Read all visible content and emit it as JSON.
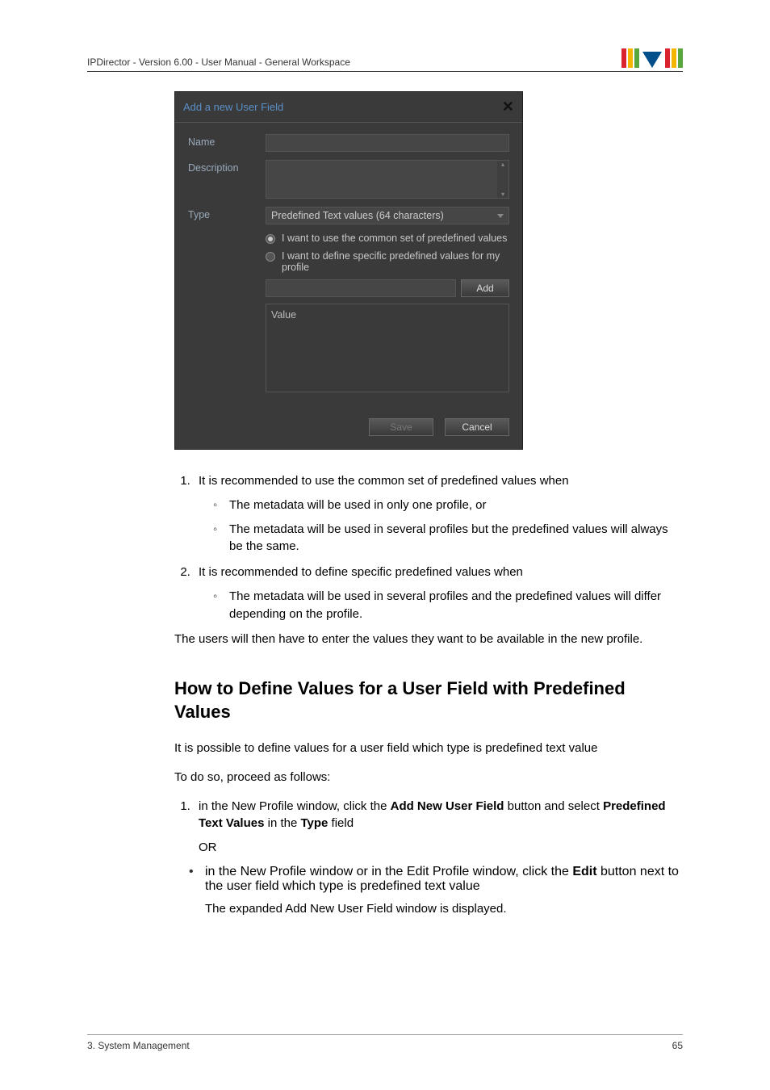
{
  "header": {
    "running_head": "IPDirector - Version 6.00 - User Manual - General Workspace"
  },
  "dialog": {
    "title": "Add a new User Field",
    "close": "✕",
    "labels": {
      "name": "Name",
      "description": "Description",
      "type": "Type"
    },
    "type_value": "Predefined Text values (64 characters)",
    "radio1": "I want to use the common set of predefined values",
    "radio2": "I want to define specific predefined values for my profile",
    "add_label": "Add",
    "value_label": "Value",
    "save_label": "Save",
    "cancel_label": "Cancel"
  },
  "body": {
    "ol1_item1": "It is recommended to use the common set of predefined values when",
    "ol1_item1_sub1": "The metadata will be used in only one profile, or",
    "ol1_item1_sub2": "The metadata will be used in several profiles but the predefined values will always be the same.",
    "ol1_item2": "It is recommended to define specific predefined values when",
    "ol1_item2_sub1": "The metadata will be used in several profiles and the predefined values will differ depending on the profile.",
    "para_after": "The users will then have to enter the values they want to be available in the new profile.",
    "heading2": "How to Define Values for a User Field with Predefined Values",
    "para_intro": "It is possible to define values for a user field which type is predefined text value",
    "para_proceed": "To do so, proceed as follows:",
    "step1_pre": "in the New Profile window, click the ",
    "step1_bold1": "Add New User Field",
    "step1_mid": " button and select ",
    "step1_bold2": "Predefined Text Values",
    "step1_mid2": " in the ",
    "step1_bold3": "Type",
    "step1_post": " field",
    "or": "OR",
    "bullet_pre": "in the New Profile window or in the Edit Profile window, click the ",
    "bullet_bold": "Edit",
    "bullet_post": " button next to the user field which type is predefined text value",
    "bullet_result": "The expanded Add New User Field window is displayed."
  },
  "footer": {
    "left": "3. System Management",
    "right": "65"
  }
}
